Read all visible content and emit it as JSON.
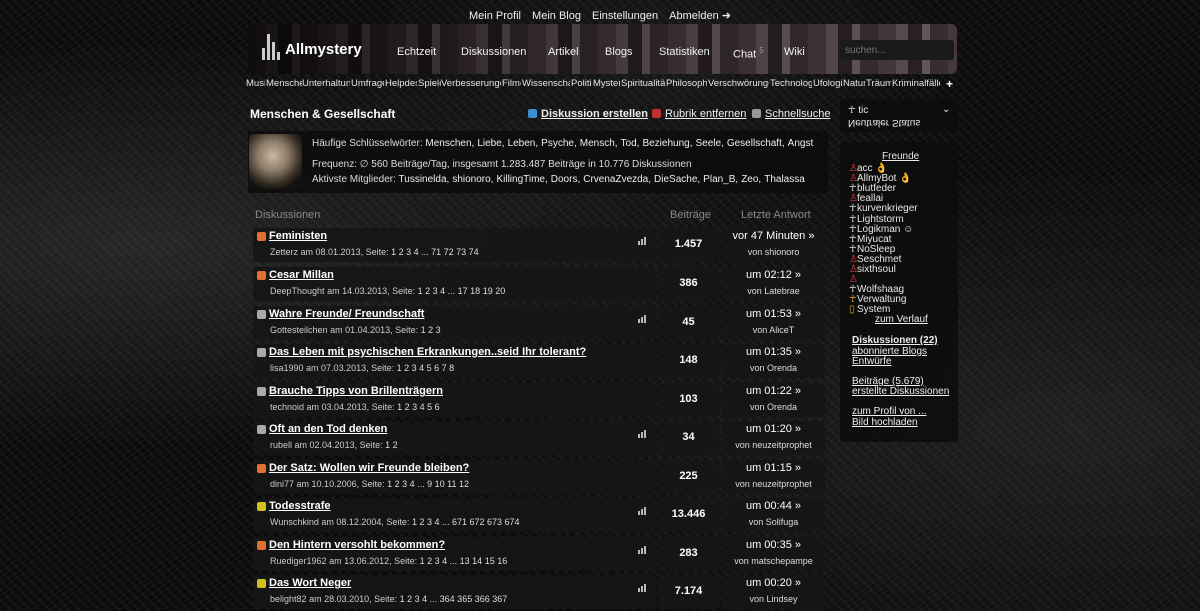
{
  "top_nav": [
    "Mein Profil",
    "Mein Blog",
    "Einstellungen",
    "Abmelden ➜"
  ],
  "brand": "Allmystery",
  "main_nav": [
    "Echtzeit",
    "Diskussionen",
    "Artikel",
    "Blogs",
    "Statistiken",
    "Chat",
    "Wiki"
  ],
  "chat_count": "5",
  "search_placeholder": "suchen...",
  "categories": [
    "Musik",
    "Menschen",
    "Unterhaltung",
    "Umfragen",
    "Helpdesk",
    "Spiele",
    "Verbesserungen",
    "Filme",
    "Wissenschaft",
    "Politik",
    "Mystery",
    "Spiritualität",
    "Philosophie",
    "Verschwörungen",
    "Technologie",
    "Ufologie",
    "Natur",
    "Träume",
    "Kriminalfälle"
  ],
  "category_plus": "+",
  "section_title": "Menschen & Gesellschaft",
  "actions": {
    "create": "Diskussion erstellen",
    "remove": "Rubrik entfernen",
    "quick": "Schnellsuche"
  },
  "keywords_label": "Häufige Schlüsselwörter:",
  "keywords": [
    "Menschen,",
    "Liebe,",
    "Leben,",
    "Psyche,",
    "Mensch,",
    "Tod,",
    "Beziehung,",
    "Seele,",
    "Gesellschaft,",
    "Angst"
  ],
  "frequency": "Frequenz: ∅ 560 Beiträge/Tag, insgesamt 1.283.487 Beiträge in 10.776 Diskussionen",
  "members_label": "Aktivste Mitglieder:",
  "members": [
    "Tussinelda,",
    "shionoro,",
    "KillingTime,",
    "Doors,",
    "CrvenaZvezda,",
    "DieSache,",
    "Plan_B,",
    "Zeo,",
    "Thalassa"
  ],
  "columns": {
    "discussions": "Diskussionen",
    "posts": "Beiträge",
    "last": "Letzte Antwort"
  },
  "threads": [
    {
      "title": "Feministen",
      "author": "Zetterz",
      "date": "am 08.01.2013, Seite:",
      "pages": "1 2 3 4 ... 71 72 73 74",
      "count": "1.457",
      "time": "vor 47 Minuten »",
      "by": "von shionoro",
      "audio": true,
      "icon_color": "#e07030"
    },
    {
      "title": "Cesar Millan",
      "author": "DeepThought",
      "date": "am 14.03.2013, Seite:",
      "pages": "1 2 3 4 ... 17 18 19 20",
      "count": "386",
      "time": "um 02:12 »",
      "by": "von Latebrae",
      "audio": false,
      "icon_color": "#e07030"
    },
    {
      "title": "Wahre Freunde/ Freundschaft",
      "author": "Gottesteilchen",
      "date": "am 01.04.2013, Seite:",
      "pages": "1 2 3",
      "count": "45",
      "time": "um 01:53 »",
      "by": "von AliceT",
      "audio": true,
      "icon_color": "#aaaaaa"
    },
    {
      "title": "Das Leben mit psychischen Erkrankungen..seid Ihr tolerant?",
      "author": "lisa1990",
      "date": "am 07.03.2013, Seite:",
      "pages": "1 2 3 4 5 6 7 8",
      "count": "148",
      "time": "um 01:35 »",
      "by": "von Orenda",
      "audio": false,
      "icon_color": "#aaaaaa"
    },
    {
      "title": "Brauche Tipps von Brillenträgern",
      "author": "technoid",
      "date": "am 03.04.2013, Seite:",
      "pages": "1 2 3 4 5 6",
      "count": "103",
      "time": "um 01:22 »",
      "by": "von Orenda",
      "audio": false,
      "icon_color": "#aaaaaa"
    },
    {
      "title": "Oft an den Tod denken",
      "author": "rubell",
      "date": "am 02.04.2013, Seite:",
      "pages": "1 2",
      "count": "34",
      "time": "um 01:20 »",
      "by": "von neuzeitprophet",
      "audio": true,
      "icon_color": "#aaaaaa"
    },
    {
      "title": "Der Satz: Wollen wir Freunde bleiben?",
      "author": "dini77",
      "date": "am 10.10.2006, Seite:",
      "pages": "1 2 3 4 ... 9 10 11 12",
      "count": "225",
      "time": "um 01:15 »",
      "by": "von neuzeitprophet",
      "audio": false,
      "icon_color": "#e07030"
    },
    {
      "title": "Todesstrafe",
      "author": "Wunschkind",
      "date": "am 08.12.2004, Seite:",
      "pages": "1 2 3 4 ... 671 672 673 674",
      "count": "13.446",
      "time": "um 00:44 »",
      "by": "von Solifuga",
      "audio": true,
      "icon_color": "#d0c020"
    },
    {
      "title": "Den Hintern versohlt bekommen?",
      "author": "Ruediger1962",
      "date": "am 13.06.2012, Seite:",
      "pages": "1 2 3 4 ... 13 14 15 16",
      "count": "283",
      "time": "um 00:35 »",
      "by": "von matschepampe",
      "audio": true,
      "icon_color": "#e07030"
    },
    {
      "title": "Das Wort Neger",
      "author": "belight82",
      "date": "am 28.03.2010, Seite:",
      "pages": "1 2 3 4 ... 364 365 366 367",
      "count": "7.174",
      "time": "um 00:20 »",
      "by": "von Lindsey",
      "audio": true,
      "icon_color": "#d0c020"
    }
  ],
  "user_box": {
    "name": "tic",
    "status": "Neutraler Status"
  },
  "friends_title": "Freunde",
  "friends": [
    {
      "name": "acc",
      "mark": "red",
      "badge": "👌"
    },
    {
      "name": "AllmyBot",
      "mark": "red",
      "badge": "👌"
    },
    {
      "name": "blutfeder",
      "mark": "white",
      "badge": ""
    },
    {
      "name": "feallai",
      "mark": "red",
      "badge": ""
    },
    {
      "name": "kurvenkrieger",
      "mark": "white",
      "badge": ""
    },
    {
      "name": "Lightstorm",
      "mark": "white",
      "badge": ""
    },
    {
      "name": "Logikman",
      "mark": "white",
      "badge": "☺"
    },
    {
      "name": "Miyucat",
      "mark": "white",
      "badge": ""
    },
    {
      "name": "NoSleep",
      "mark": "white",
      "badge": ""
    },
    {
      "name": "Seschmet",
      "mark": "red",
      "badge": ""
    },
    {
      "name": "sixthsoul",
      "mark": "red",
      "badge": ""
    },
    {
      "name": "",
      "mark": "red",
      "badge": ""
    },
    {
      "name": "Wolfshaag",
      "mark": "white",
      "badge": ""
    },
    {
      "name": "Verwaltung",
      "mark": "orange",
      "badge": ""
    },
    {
      "name": "System",
      "mark": "orange",
      "badge": ""
    }
  ],
  "history_link": "zum Verlauf",
  "sidebar_links": {
    "discussions": "Diskussionen (22)",
    "blogs": "abonnierte Blogs",
    "drafts": "Entwürfe",
    "posts": "Beiträge (5.679)",
    "created": "erstellte Diskussionen",
    "profile": "zum Profil von ...",
    "upload": "Bild hochladen"
  },
  "colors": {
    "accent_orange": "#e07030",
    "accent_yellow": "#d0c020",
    "accent_red": "#d04040",
    "panel": "#161616"
  }
}
